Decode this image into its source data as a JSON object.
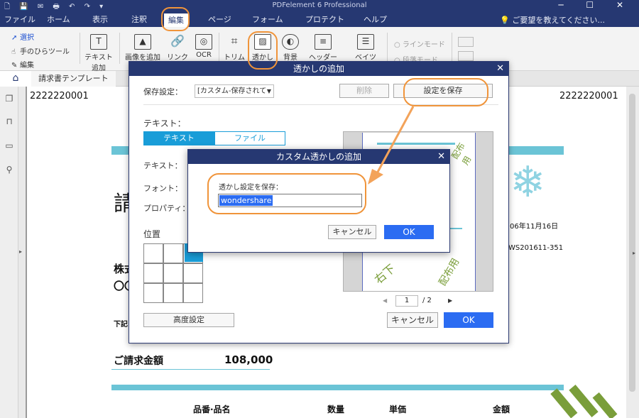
{
  "titlebar": {
    "title": "PDFelement 6 Professional",
    "quick_access": "🗋 💾 ✉ 🖶 ↶ ↷ ▾",
    "window_controls": "─ ☐ ✕"
  },
  "menu": {
    "items": [
      "ファイル",
      "ホーム",
      "表示",
      "注釈",
      "編集",
      "ページ",
      "フォーム",
      "プロテクト",
      "ヘルプ"
    ],
    "help_search": "ご要望を教えてください..."
  },
  "ribbon": {
    "select": "選択",
    "hand": "手のひらツール",
    "edit": "編集",
    "add_text_1": "テキスト",
    "add_text_2": "追加",
    "add_image": "画像を追加",
    "link": "リンク",
    "ocr": "OCR",
    "trim": "トリム",
    "watermark": "透かし",
    "background": "背景",
    "header": "ヘッダー",
    "bates": "ベイツ",
    "line_mode": "ラインモード",
    "paragraph_mode": "段落モード"
  },
  "tabs": {
    "doc_tab": "請求書テンプレート"
  },
  "document": {
    "num_left": "2222220001",
    "num_right": "2222220001",
    "heading_char": "請",
    "company_line1": "株式",
    "company_line2": "〇〇",
    "date_text": "06年11月16日",
    "code_text": "WS201611-351",
    "below_line": "下記",
    "amount_label": "ご請求金額",
    "amount_value": "108,000",
    "col_item": "品番·品名",
    "col_qty": "数量",
    "col_price": "単価",
    "col_amount": "金額"
  },
  "dialog_watermark": {
    "title": "透かしの追加",
    "save_settings_label": "保存設定：",
    "save_settings_value": "[カスタム-保存されて",
    "delete_button": "削除",
    "save_button": "設定を保存",
    "text_section": "テキスト：",
    "segment_text": "テキスト",
    "segment_file": "ファイル",
    "text_label": "テキスト：",
    "font_label": "フォント：",
    "property_label": "プロパティ：",
    "position_label": "位置",
    "advanced_button": "高度設定",
    "page_current": "1",
    "page_total": "/ 2",
    "cancel_button": "キャンセル",
    "ok_button": "OK"
  },
  "dialog_custom": {
    "title": "カスタム透かしの追加",
    "prompt": "透かし設定を保存：",
    "input_value": "wondershare",
    "cancel_button": "キャンセル",
    "ok_button": "OK"
  },
  "preview_watermark": {
    "text1": "右下",
    "text2": "配布用",
    "text3": "配布用"
  },
  "colors": {
    "titlebar": "#263872",
    "accent": "#2b6cf2",
    "segment": "#199dd8",
    "highlight": "#f0943a",
    "watermark_green": "#7a9e3a",
    "doc_teal": "#6bc4d6"
  }
}
